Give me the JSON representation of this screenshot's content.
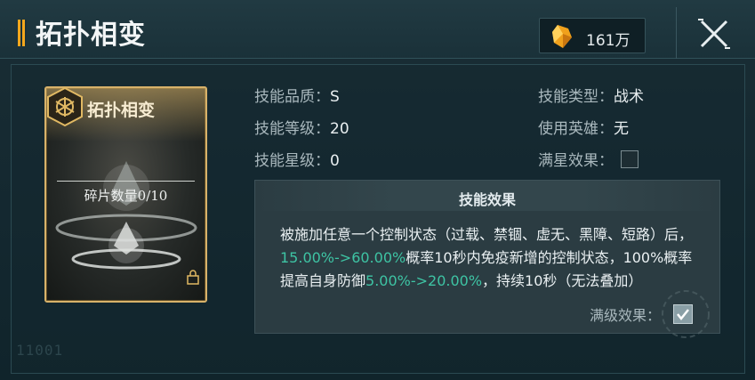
{
  "header": {
    "title": "拓扑相变",
    "currency_value": "161万"
  },
  "card": {
    "name": "拓扑相变",
    "fragment_label": "碎片数量0/10"
  },
  "info": {
    "quality_label": "技能品质：",
    "quality_value": "S",
    "level_label": "技能等级：",
    "level_value": "20",
    "star_label": "技能星级：",
    "star_value": "0",
    "type_label": "技能类型：",
    "type_value": "战术",
    "hero_label": "使用英雄：",
    "hero_value": "无",
    "fullstar_label": "满星效果：",
    "fullstar_checked": false
  },
  "effect": {
    "title": "技能效果",
    "text_1": "被施加任意一个控制状态（过载、禁锢、虚无、黑障、短路）后，",
    "highlight_1": "15.00%->60.00%",
    "text_2": "概率10秒内免疫新增的控制状态，100%概率提高自身防御",
    "highlight_2": "5.00%->20.00%",
    "text_3": "，持续10秒（无法叠加）",
    "max_level_label": "满级效果：",
    "max_level_checked": true
  },
  "decoration": {
    "code": "11001"
  },
  "colors": {
    "accent_gold": "#d8b26a",
    "highlight_green": "#3ec4a4",
    "title_stripe": "#f3a71d"
  }
}
